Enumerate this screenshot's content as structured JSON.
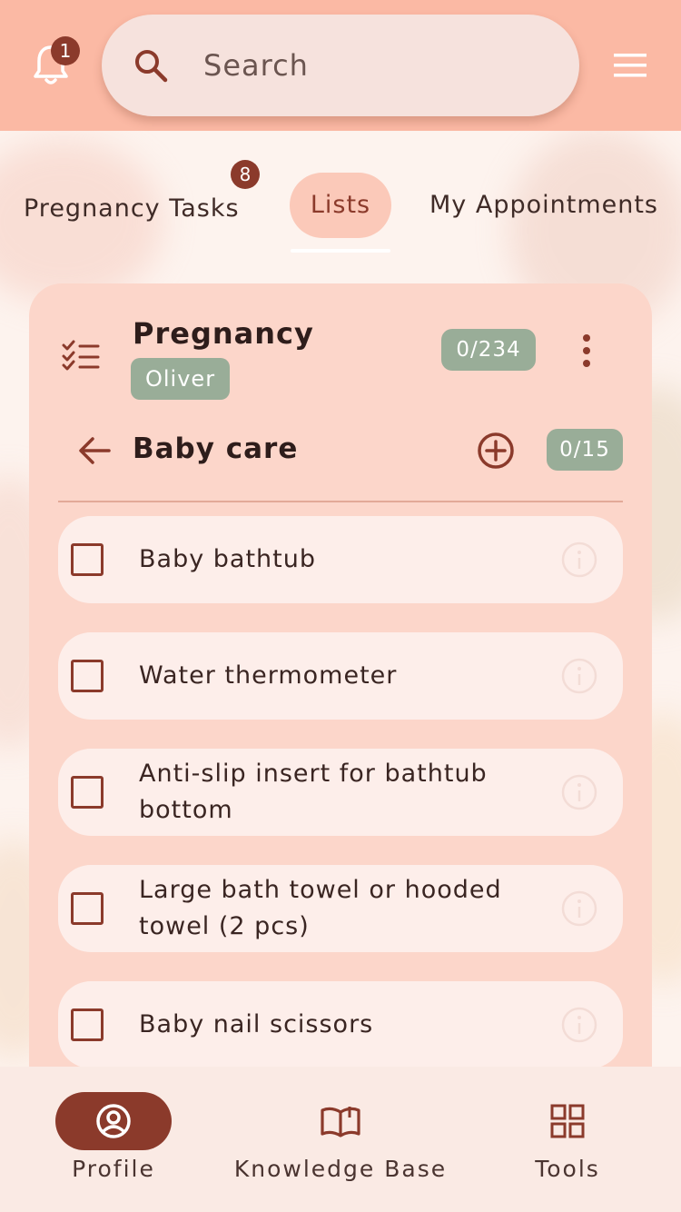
{
  "header": {
    "notification_count": "1",
    "search_placeholder": "Search"
  },
  "tabs": [
    {
      "label": "Pregnancy Tasks",
      "badge": "8"
    },
    {
      "label": "Lists",
      "selected": true
    },
    {
      "label": "My Appointments"
    }
  ],
  "list": {
    "title": "Pregnancy",
    "owner": "Oliver",
    "progress": "0/234",
    "category": {
      "title": "Baby care",
      "progress": "0/15"
    },
    "items": [
      {
        "label": "Baby bathtub",
        "checked": false
      },
      {
        "label": "Water thermometer",
        "checked": false
      },
      {
        "label": "Anti-slip insert for bathtub bottom",
        "checked": false
      },
      {
        "label": "Large bath towel or hooded towel (2 pcs)",
        "checked": false
      },
      {
        "label": "Baby nail scissors",
        "checked": false
      }
    ]
  },
  "bottom_nav": [
    {
      "label": "Profile",
      "icon": "profile-icon",
      "active": true
    },
    {
      "label": "Knowledge Base",
      "icon": "book-icon"
    },
    {
      "label": "Tools",
      "icon": "grid-icon"
    }
  ],
  "colors": {
    "header_bg": "#fbb9a4",
    "accent": "#8b3a2b",
    "chip_green": "#99ad98",
    "card_bg": "#fcd6ca",
    "item_bg": "#fdeeea"
  }
}
